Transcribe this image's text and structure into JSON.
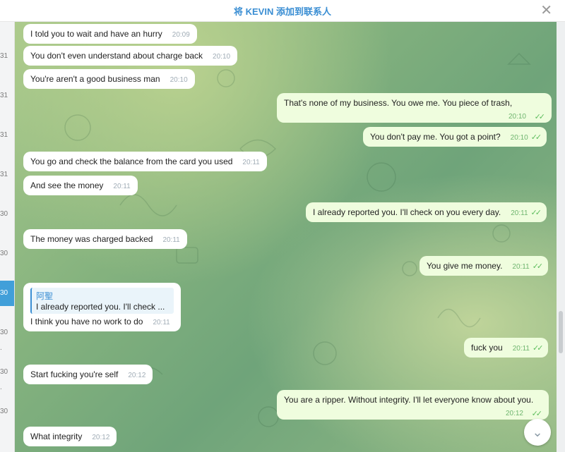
{
  "header": {
    "title": "将 KEVIN 添加到联系人",
    "close_icon": "close-icon"
  },
  "left_strip": {
    "marks": [
      "31",
      "31",
      "31",
      "31",
      "31",
      "30",
      "30",
      "30",
      "30",
      ".",
      "30",
      ".",
      "30"
    ]
  },
  "messages": [
    {
      "dir": "in",
      "text": "I told you to wait and have an hurry",
      "time": "20:09"
    },
    {
      "dir": "in",
      "text": "You don't even understand about charge back",
      "time": "20:10"
    },
    {
      "dir": "in",
      "text": "You're aren't a good business man",
      "time": "20:10"
    },
    {
      "dir": "out",
      "text": "That's none of my business. You owe me. You piece of trash,",
      "time": "20:10"
    },
    {
      "dir": "out",
      "text": "You don't pay me. You got a point?",
      "time": "20:10"
    },
    {
      "dir": "in",
      "text": "You go and check the balance from the card you used",
      "time": "20:11"
    },
    {
      "dir": "in",
      "text": "And see the money",
      "time": "20:11"
    },
    {
      "dir": "out",
      "text": "I already reported you. I'll check on you every day.",
      "time": "20:11"
    },
    {
      "dir": "in",
      "text": "The money was charged backed",
      "time": "20:11"
    },
    {
      "dir": "out",
      "text": "You give me money.",
      "time": "20:11"
    },
    {
      "dir": "in",
      "reply_name": "阿聖",
      "reply_text": "I already reported you. I'll check ...",
      "text": "I think you have no work to do",
      "time": "20:11"
    },
    {
      "dir": "out",
      "text": "fuck you",
      "time": "20:11"
    },
    {
      "dir": "in",
      "text": "Start fucking you're self",
      "time": "20:12"
    },
    {
      "dir": "out",
      "text": "You are a ripper. Without integrity. I'll let everyone know about you.",
      "time": "20:12"
    },
    {
      "dir": "in",
      "text": "What integrity",
      "time": "20:12"
    }
  ],
  "read_check": "✓✓",
  "scroll_down_icon": "chevron-down-icon",
  "scroll_down_glyph": "⌄",
  "close_glyph": "✕"
}
